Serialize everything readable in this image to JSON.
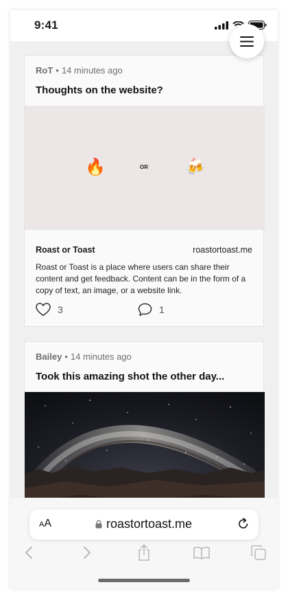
{
  "status_bar": {
    "time": "9:41"
  },
  "posts": [
    {
      "author": "RoT",
      "time_ago": "14 minutes ago",
      "title": "Thoughts on the website?",
      "media": {
        "left_emoji": "🔥",
        "middle_text": "OR",
        "right_emoji": "🍻"
      },
      "link": {
        "site_name": "Roast or Toast",
        "domain": "roastortoast.me",
        "description": "Roast or Toast is a place where users can share their content and get feedback. Content can be in the form of a copy of text, an image, or a website link."
      },
      "likes": "3",
      "comments": "1"
    },
    {
      "author": "Bailey",
      "time_ago": "14 minutes ago",
      "title": "Took this amazing shot the other day..."
    }
  ],
  "browser": {
    "text_size_label_small": "A",
    "text_size_label_large": "A",
    "url": "roastortoast.me"
  },
  "icons": {
    "menu": "hamburger-menu-icon",
    "like": "heart-icon",
    "comment": "speech-bubble-icon",
    "lock": "lock-icon",
    "reload": "reload-icon",
    "back": "chevron-left-icon",
    "forward": "chevron-right-icon",
    "share": "share-icon",
    "bookmarks": "book-icon",
    "tabs": "tabs-icon"
  },
  "colors": {
    "page_bg": "#f1f0f1",
    "card_bg": "#fbfafb",
    "media_bg": "#ece7e6"
  }
}
